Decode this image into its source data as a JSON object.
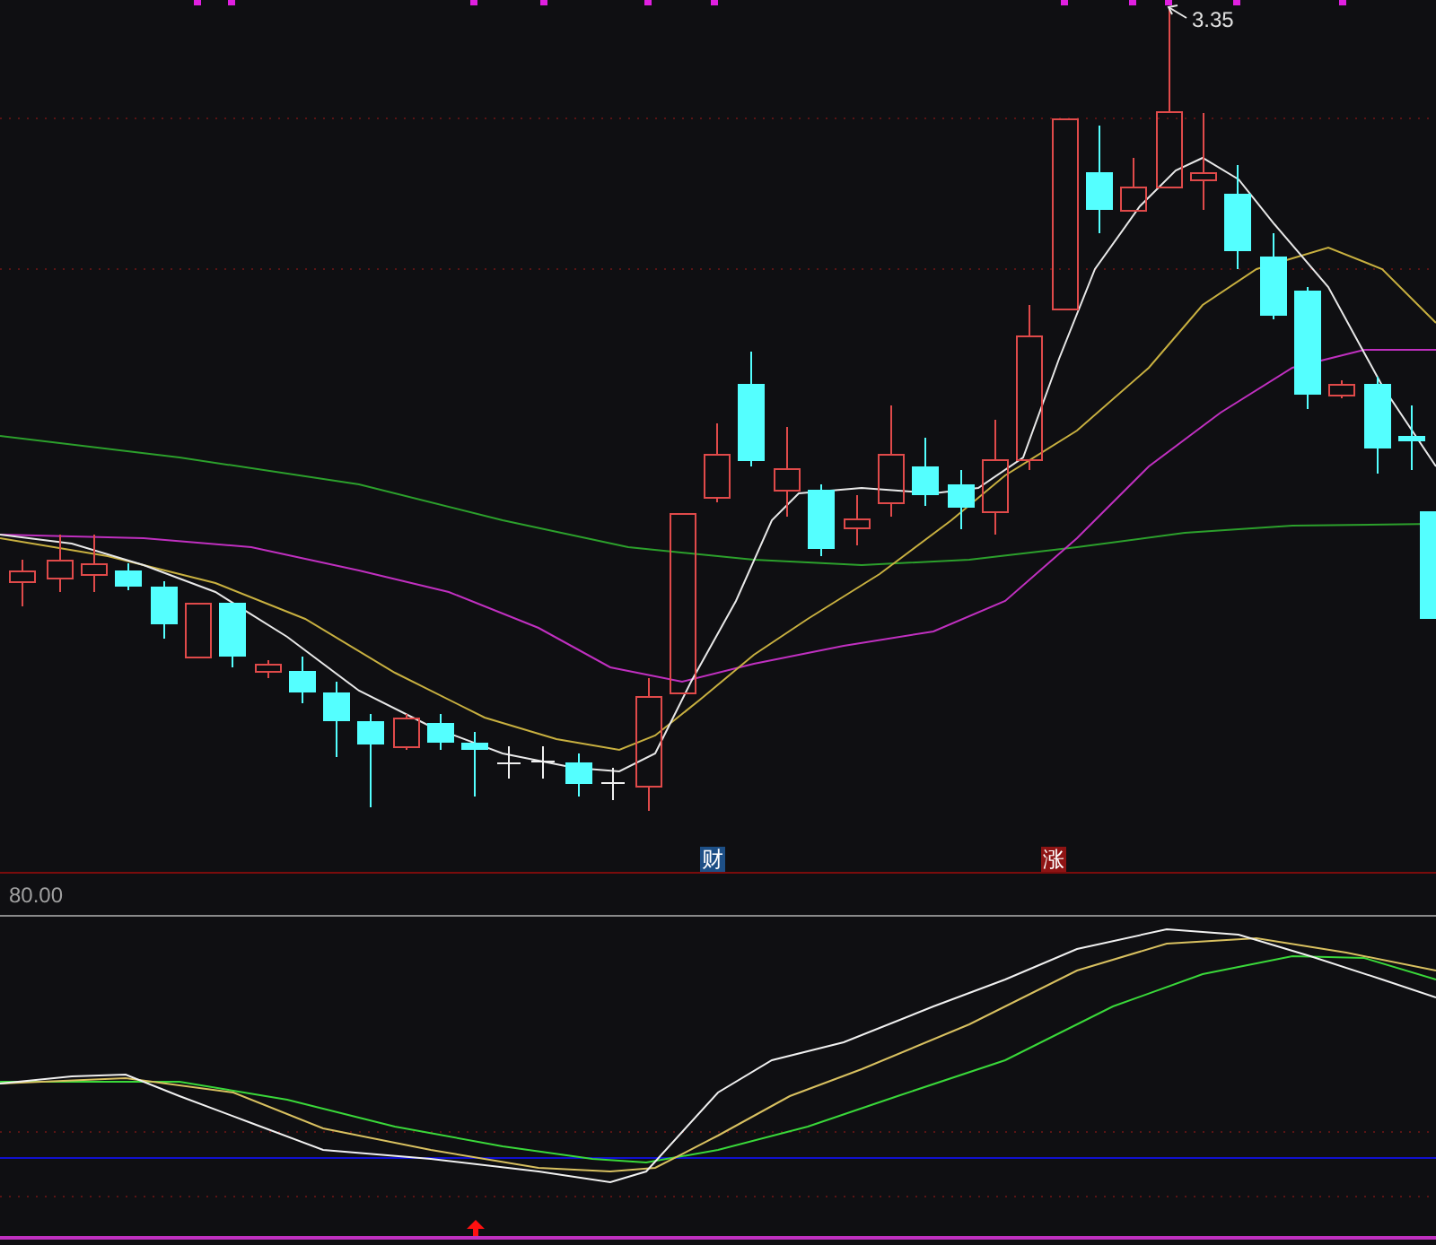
{
  "price_chart": {
    "high_label": "3.35",
    "markers": [
      {
        "text": "财",
        "color": "#1d4f86"
      },
      {
        "text": "涨",
        "color": "#8e1414"
      }
    ]
  },
  "indicator": {
    "reference_value": "80.00"
  }
}
